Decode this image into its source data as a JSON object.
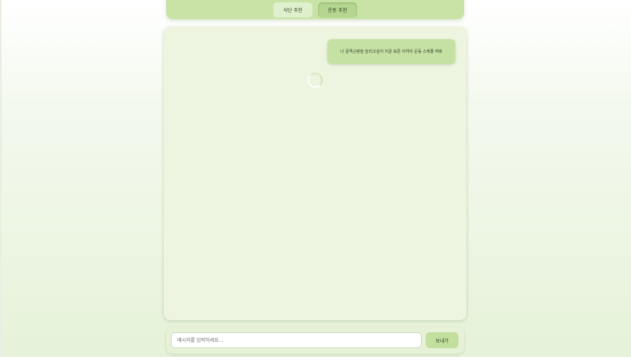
{
  "tabs": [
    {
      "label": "식단 추천",
      "active": false
    },
    {
      "label": "운동 추천",
      "active": true
    }
  ],
  "chat": {
    "messages": [
      {
        "role": "user",
        "text": "나 골격근량을 늘리고싶어 지금 표준 이하야 운동 스케쥴 짜봐"
      }
    ],
    "loading": true
  },
  "input": {
    "placeholder": "메시지를 입력하세요...",
    "value": ""
  },
  "send_button": {
    "label": "보내기"
  },
  "colors": {
    "accent": "#c8e3a5",
    "active_tab": "#b4d68f",
    "panel": "#edf5e1",
    "user_bubble": "#c6e1a4"
  }
}
